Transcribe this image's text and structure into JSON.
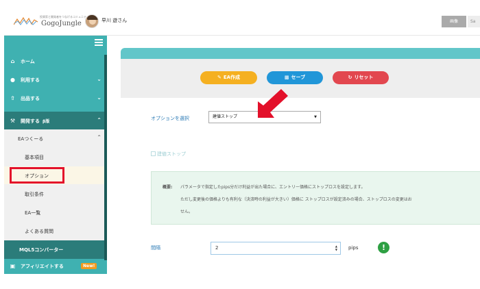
{
  "header": {
    "logo_tagline": "投資家と開発者をつなげるコミュニティ",
    "logo_text": "GogoJungle",
    "user_name": "早川 遊さん",
    "search_button": "画像",
    "search_placeholder": "Sa"
  },
  "sidebar": {
    "items": [
      {
        "label": "ホーム",
        "icon": "home-icon"
      },
      {
        "label": "利用する",
        "icon": "user-circle-icon"
      },
      {
        "label": "出品する",
        "icon": "upload-icon"
      },
      {
        "label": "開発する",
        "badge": "β版",
        "icon": "wrench-icon"
      }
    ],
    "sub": {
      "parent": "EAつくーる",
      "children": [
        "基本項目",
        "オプション",
        "取引条件",
        "EA一覧",
        "よくある質問"
      ]
    },
    "mql": "MQL5コンバーター",
    "affiliate": {
      "label": "アフィリエイトする",
      "badge": "New!"
    }
  },
  "toolbar": {
    "ea_create": "EA作成",
    "save": "セーブ",
    "reset": "リセット"
  },
  "form": {
    "option_label": "オプションを選択",
    "option_selected": "建値ストップ",
    "checkbox_label": "建値ストップ",
    "info_title": "概要:",
    "info_lines": [
      "パラメータで指定したpips分だけ利益が出た場合に、エントリー価格にストップロスを設定します。",
      "ただし変更後の価格よりも有利な（決済時の利益が大きい）価格に ストップロスが設定済みの場合、ストップロスの変更はお",
      "せん。"
    ],
    "interval_label": "間隔",
    "interval_value": "2",
    "interval_unit": "pips"
  },
  "colors": {
    "sidebar_light": "#3fb1b1",
    "sidebar_dark": "#2b7c7a",
    "ea_button": "#f5b021",
    "save_button": "#2196d8",
    "reset_button": "#e2474f",
    "annotation_red": "#e3102a"
  }
}
